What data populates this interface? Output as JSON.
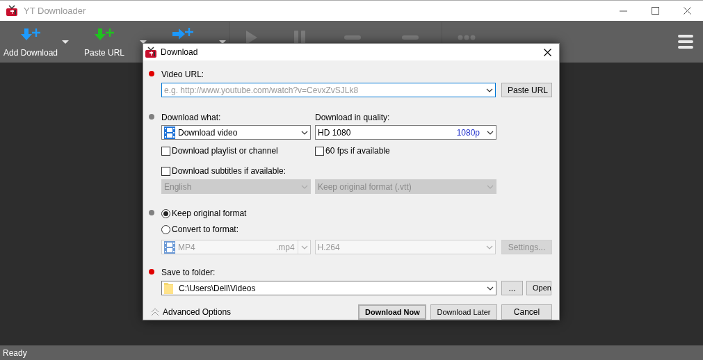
{
  "window": {
    "title": "YT Downloader"
  },
  "toolbar": {
    "buttons": [
      {
        "kind": "add",
        "label": "Add Download",
        "has_menu": true
      },
      {
        "kind": "paste",
        "label": "Paste URL",
        "has_menu": true
      },
      {
        "kind": "convert",
        "has_menu": true
      },
      {
        "kind": "play",
        "disabled": true
      },
      {
        "kind": "pause",
        "disabled": true
      },
      {
        "kind": "stop",
        "disabled": true
      },
      {
        "kind": "remove",
        "disabled": true
      },
      {
        "kind": "more",
        "disabled": true
      }
    ]
  },
  "dialog": {
    "title": "Download",
    "url_section": {
      "color": "#e00000",
      "label": "Video URL:",
      "placeholder": "e.g. http://www.youtube.com/watch?v=CevxZvSJLk8",
      "button": "Paste URL"
    },
    "what_section": {
      "color": "#808080",
      "what_label": "Download what:",
      "what_value": "Download video",
      "quality_label": "Download in quality:",
      "quality_value": "HD 1080",
      "quality_badge": "1080p",
      "checkboxes": [
        {
          "label": "Download playlist or channel",
          "checked": false
        },
        {
          "label": "60 fps if available",
          "checked": false
        }
      ],
      "subtitles": {
        "label": "Download subtitles if available:",
        "checked": false,
        "language": "English",
        "format": "Keep original format (.vtt)",
        "disabled": true
      }
    },
    "format_section": {
      "color": "#808080",
      "options": [
        {
          "label": "Keep original format",
          "selected": true
        },
        {
          "label": "Convert to format:",
          "selected": false
        }
      ],
      "disabled": true,
      "container": "MP4",
      "extension": ".mp4",
      "codec": "H.264",
      "settings_button": "Settings..."
    },
    "folder_section": {
      "color": "#e00000",
      "label": "Save to folder:",
      "path": "C:\\Users\\Dell\\Videos",
      "browse_button": "...",
      "open_button": "Open"
    },
    "footer": {
      "advanced": "Advanced Options",
      "buttons": [
        {
          "label": "Download Now",
          "default": true
        },
        {
          "label": "Download Later",
          "default": false
        },
        {
          "label": "Cancel",
          "default": false
        }
      ]
    }
  },
  "status_bar": {
    "text": "Ready"
  }
}
